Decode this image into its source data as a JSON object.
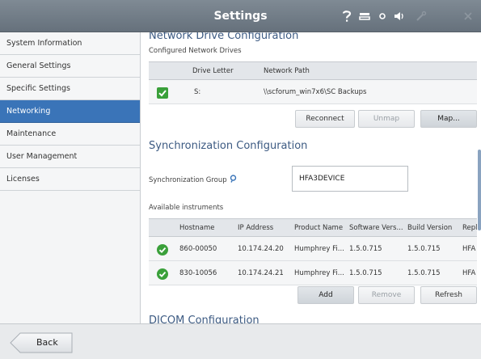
{
  "window": {
    "title": "Settings"
  },
  "titlebar_icons": [
    "help-icon",
    "keyboard-icon",
    "network-status-icon",
    "volume-icon",
    "tools-icon",
    "close-icon"
  ],
  "sidebar": {
    "items": [
      {
        "label": "System Information",
        "active": false
      },
      {
        "label": "General Settings",
        "active": false
      },
      {
        "label": "Specific Settings",
        "active": false
      },
      {
        "label": "Networking",
        "active": true
      },
      {
        "label": "Maintenance",
        "active": false
      },
      {
        "label": "User Management",
        "active": false
      },
      {
        "label": "Licenses",
        "active": false
      }
    ]
  },
  "network_drive": {
    "title": "Network Drive Configuration",
    "subtitle": "Configured Network Drives",
    "headers": [
      "Drive Letter",
      "Network Path"
    ],
    "rows": [
      {
        "checked": true,
        "drive_letter": "S:",
        "network_path": "\\\\scforum_win7x6\\SC Backups"
      }
    ],
    "buttons": {
      "reconnect": "Reconnect",
      "unmap": "Unmap",
      "map": "Map..."
    }
  },
  "synchronization": {
    "title": "Synchronization Configuration",
    "group_label": "Synchronization Group",
    "group_value": "HFA3DEVICE",
    "instruments_label": "Available instruments",
    "headers": [
      "Hostname",
      "IP Address",
      "Product Name",
      "Software Vers...",
      "Build Version",
      "Repl"
    ],
    "rows": [
      {
        "checked": true,
        "hostname": "860-00050",
        "ip": "10.174.24.20",
        "product": "Humphrey Fi...",
        "software": "1.5.0.715",
        "build": "1.5.0.715",
        "repl": "HFA"
      },
      {
        "checked": true,
        "hostname": "830-10056",
        "ip": "10.174.24.21",
        "product": "Humphrey Fi...",
        "software": "1.5.0.715",
        "build": "1.5.0.715",
        "repl": "HFA"
      }
    ],
    "buttons": {
      "add": "Add",
      "remove": "Remove",
      "refresh": "Refresh"
    }
  },
  "dicom": {
    "title": "DICOM Configuration"
  },
  "footer": {
    "back_label": "Back"
  },
  "colors": {
    "titlebar": "#6f7a85",
    "active": "#3a74b8",
    "check_green": "#3aa03a"
  }
}
